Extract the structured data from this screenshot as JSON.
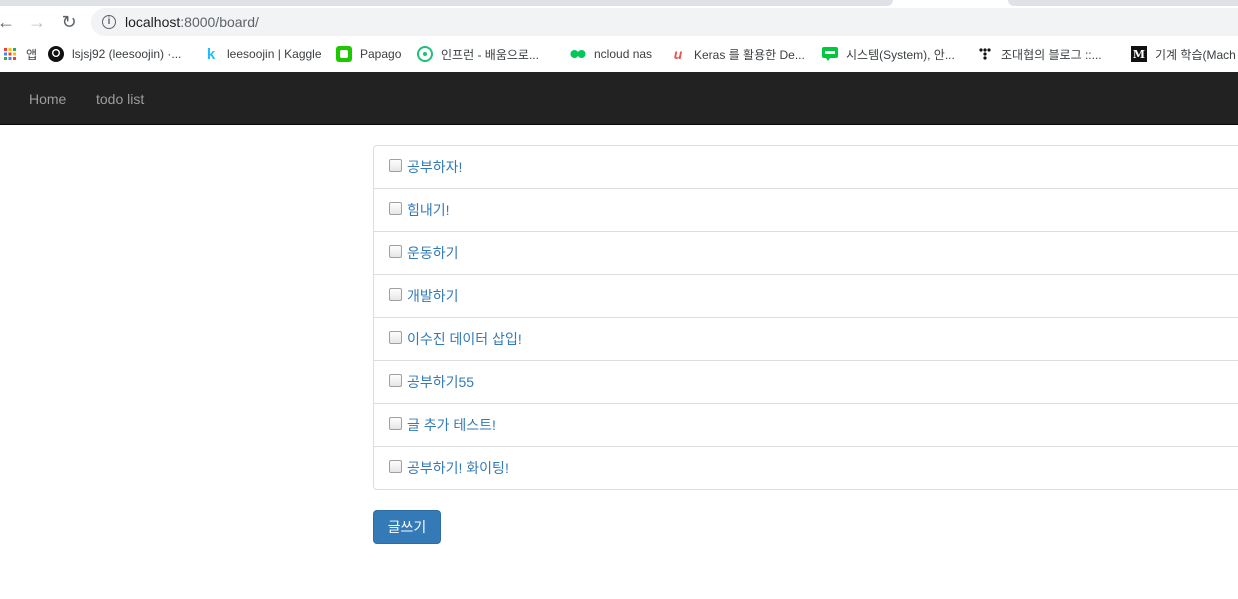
{
  "browser": {
    "url_host": "localhost",
    "url_path": ":8000/board/"
  },
  "bookmarks": [
    {
      "label": "앱",
      "icon": "apps-grid-icon",
      "color": "#ea4335"
    },
    {
      "label": "lsjsj92 (leesoojin) ·...",
      "icon": "github-icon",
      "color": "#000000"
    },
    {
      "label": "leesoojin | Kaggle",
      "icon": "kaggle-icon",
      "color": "#20beff"
    },
    {
      "label": "Papago",
      "icon": "papago-icon",
      "color": "#1ec800"
    },
    {
      "label": "인프런 - 배움으로...",
      "icon": "inflearn-icon",
      "color": "#1dc078"
    },
    {
      "label": "ncloud nas",
      "icon": "ncloud-icon",
      "color": "#03c75a"
    },
    {
      "label": "Keras 를 활용한 De...",
      "icon": "udemy-icon",
      "color": "#ec5252"
    },
    {
      "label": "시스템(System), 안...",
      "icon": "blog-icon",
      "color": "#00c73c"
    },
    {
      "label": "조대협의 블로그 ::...",
      "icon": "tistory-icon",
      "color": "#000000"
    },
    {
      "label": "기계 학습(Mach",
      "icon": "medium-icon",
      "color": "#000000"
    }
  ],
  "navbar": {
    "home": "Home",
    "todo": "todo list"
  },
  "todos": [
    "공부하자!",
    "힘내기!",
    "운동하기",
    "개발하기",
    "이수진 데이터 삽입!",
    "공부하기55",
    "글 추가 테스트!",
    "공부하기! 화이팅!"
  ],
  "write_button": "글쓰기",
  "colors": {
    "navbar_bg": "#222222",
    "link": "#337ab7",
    "primary_button": "#337ab7"
  }
}
